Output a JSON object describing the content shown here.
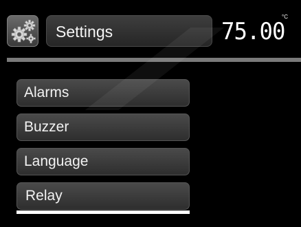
{
  "header": {
    "icon": "gears-icon",
    "title": "Settings",
    "temperature": "75.00",
    "temperature_unit": "°C"
  },
  "menu": {
    "items": [
      {
        "label": "Alarms"
      },
      {
        "label": "Buzzer"
      },
      {
        "label": "Language"
      },
      {
        "label": "Relay"
      }
    ],
    "selected_index": 3
  },
  "colors": {
    "background": "#000000",
    "button": "#3a3a3a",
    "divider": "#7a7a7a",
    "selection": "#ffffff"
  }
}
